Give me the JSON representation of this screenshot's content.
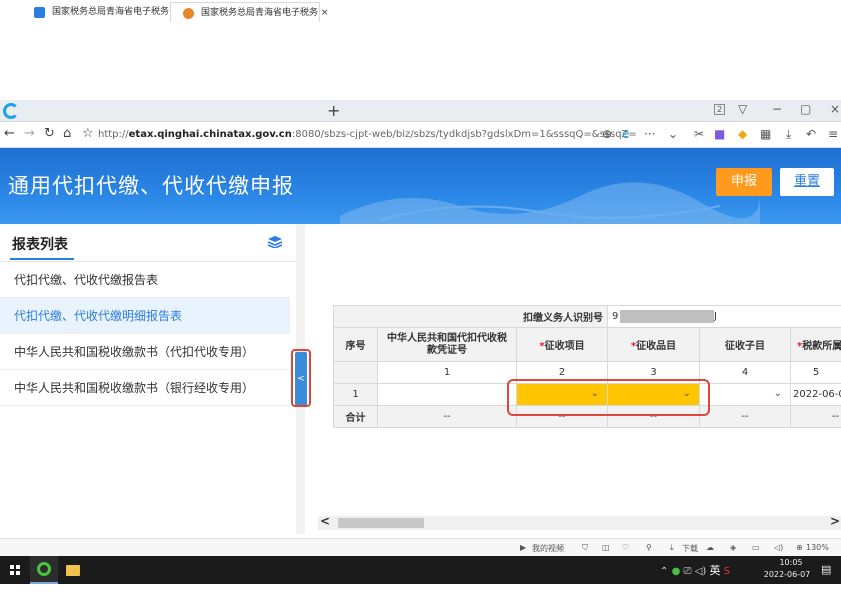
{
  "browser": {
    "tabs": [
      {
        "label": "国家税务总局青海省电子税务 ×",
        "active": false
      },
      {
        "label": "国家税务总局青海省电子税务 ×",
        "active": true
      }
    ],
    "url_prefix": "http://",
    "url_host": "etax.qinghai.chinatax.gov.cn",
    "url_rest": ":8080/sbzs-cjpt-web/biz/sbzs/tydkdjsb?gdslxDm=1&sssqQ=&sssqZ=",
    "tab_count": "2"
  },
  "header": {
    "title": "通用代扣代缴、代收代缴申报",
    "submit_label": "申报",
    "reset_label": "重置"
  },
  "sidebar": {
    "title": "报表列表",
    "items": [
      {
        "label": "代扣代缴、代收代缴报告表"
      },
      {
        "label": "代扣代缴、代收代缴明细报告表"
      },
      {
        "label": "中华人民共和国税收缴款书（代扣代收专用）"
      },
      {
        "label": "中华人民共和国税收缴款书（银行经收专用）"
      }
    ]
  },
  "table": {
    "taxpayer_id_label": "扣缴义务人识别号",
    "taxpayer_id_start": "9",
    "taxpayer_id_end": "J",
    "headers": {
      "seq": "序号",
      "cert_line1": "中华人民共和国代扣代收税",
      "cert_line2": "款凭证号",
      "levy_item": "征收项目",
      "levy_product": "征收品目",
      "levy_sub": "征收子目",
      "tax_period": "税款所属"
    },
    "col_numbers": [
      "1",
      "2",
      "3",
      "4",
      "5"
    ],
    "row": {
      "seq": "1",
      "date": "2022-06-0"
    },
    "total": {
      "label": "合计",
      "dash": "--"
    }
  },
  "statusbar": {
    "video": "我的视频",
    "download": "下载",
    "zoom": "130%"
  },
  "taskbar": {
    "ime": "英",
    "time": "10:05",
    "date": "2022-06-07"
  },
  "colors": {
    "accent_blue": "#2a7de1",
    "submit_orange": "#ff9a1f",
    "select_yellow": "#ffc600",
    "highlight_red": "#e0453a"
  }
}
